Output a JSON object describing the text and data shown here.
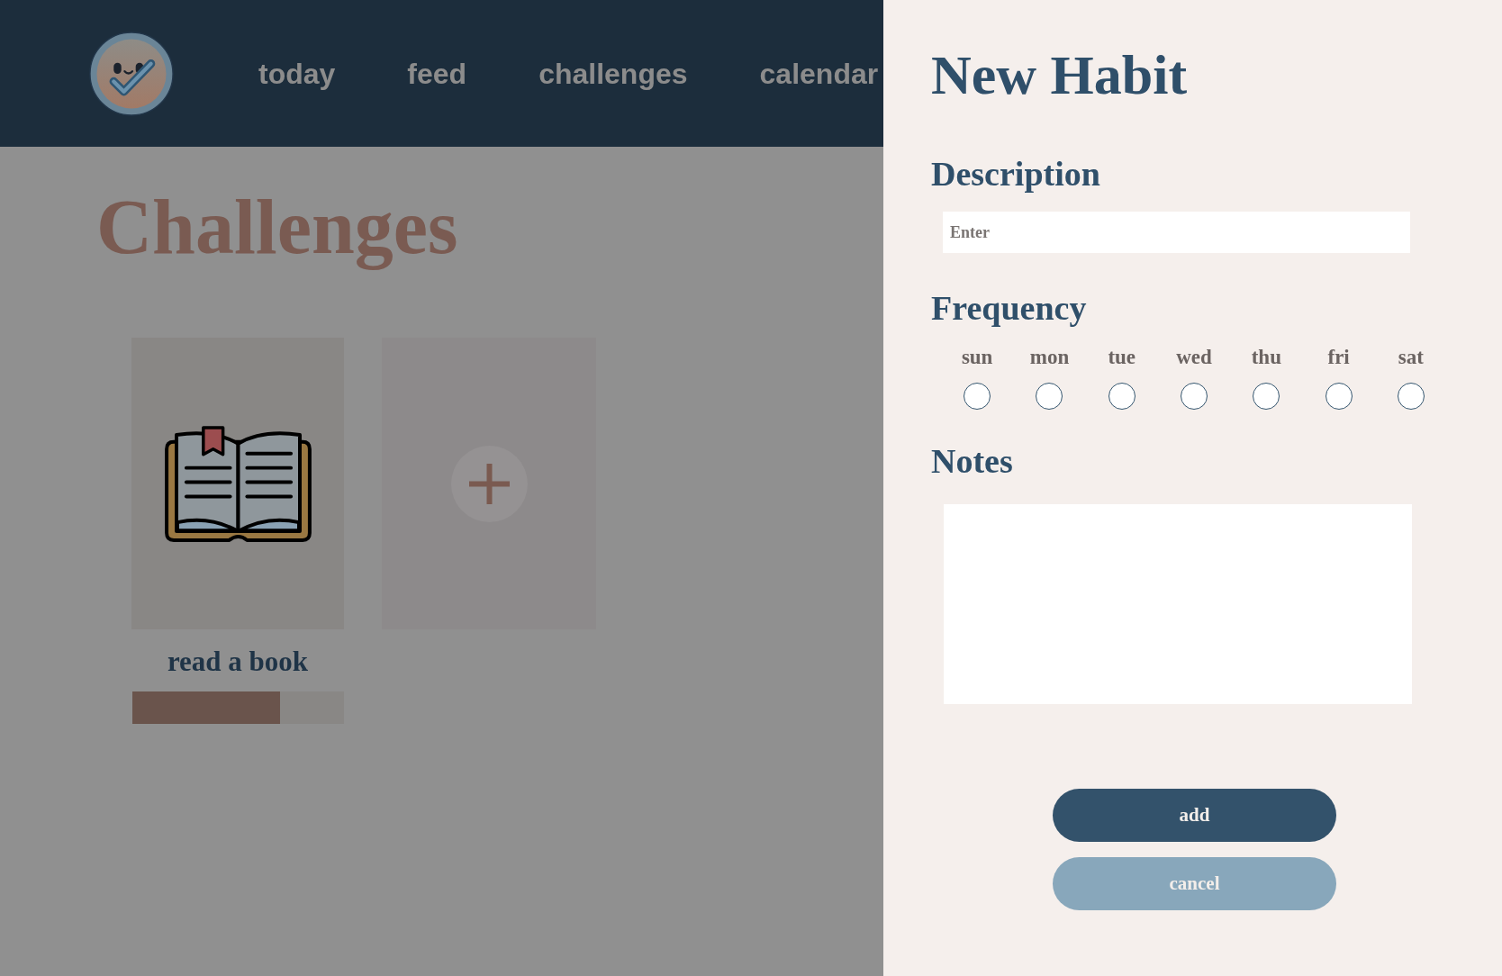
{
  "nav": {
    "links": [
      {
        "label": "today"
      },
      {
        "label": "feed"
      },
      {
        "label": "challenges"
      },
      {
        "label": "calendar"
      }
    ]
  },
  "page": {
    "title": "Challenges",
    "challenges": [
      {
        "kind": "habit",
        "name": "read a book",
        "level": 0.7
      },
      {
        "kind": "add"
      }
    ]
  },
  "dialog": {
    "title": "New Habit",
    "description": {
      "label": "Description",
      "placeholder": "Enter"
    },
    "frequency": {
      "label": "Frequency",
      "days": [
        {
          "label": "sun",
          "checked": false
        },
        {
          "label": "mon",
          "checked": false
        },
        {
          "label": "tue",
          "checked": false
        },
        {
          "label": "wed",
          "checked": false
        },
        {
          "label": "thu",
          "checked": false
        },
        {
          "label": "fri",
          "checked": false
        },
        {
          "label": "sat",
          "checked": false
        }
      ]
    },
    "notes": {
      "label": "Notes"
    },
    "buttons": [
      {
        "label": "add",
        "kind": "primary"
      },
      {
        "label": "cancel",
        "kind": "secondary"
      }
    ]
  }
}
